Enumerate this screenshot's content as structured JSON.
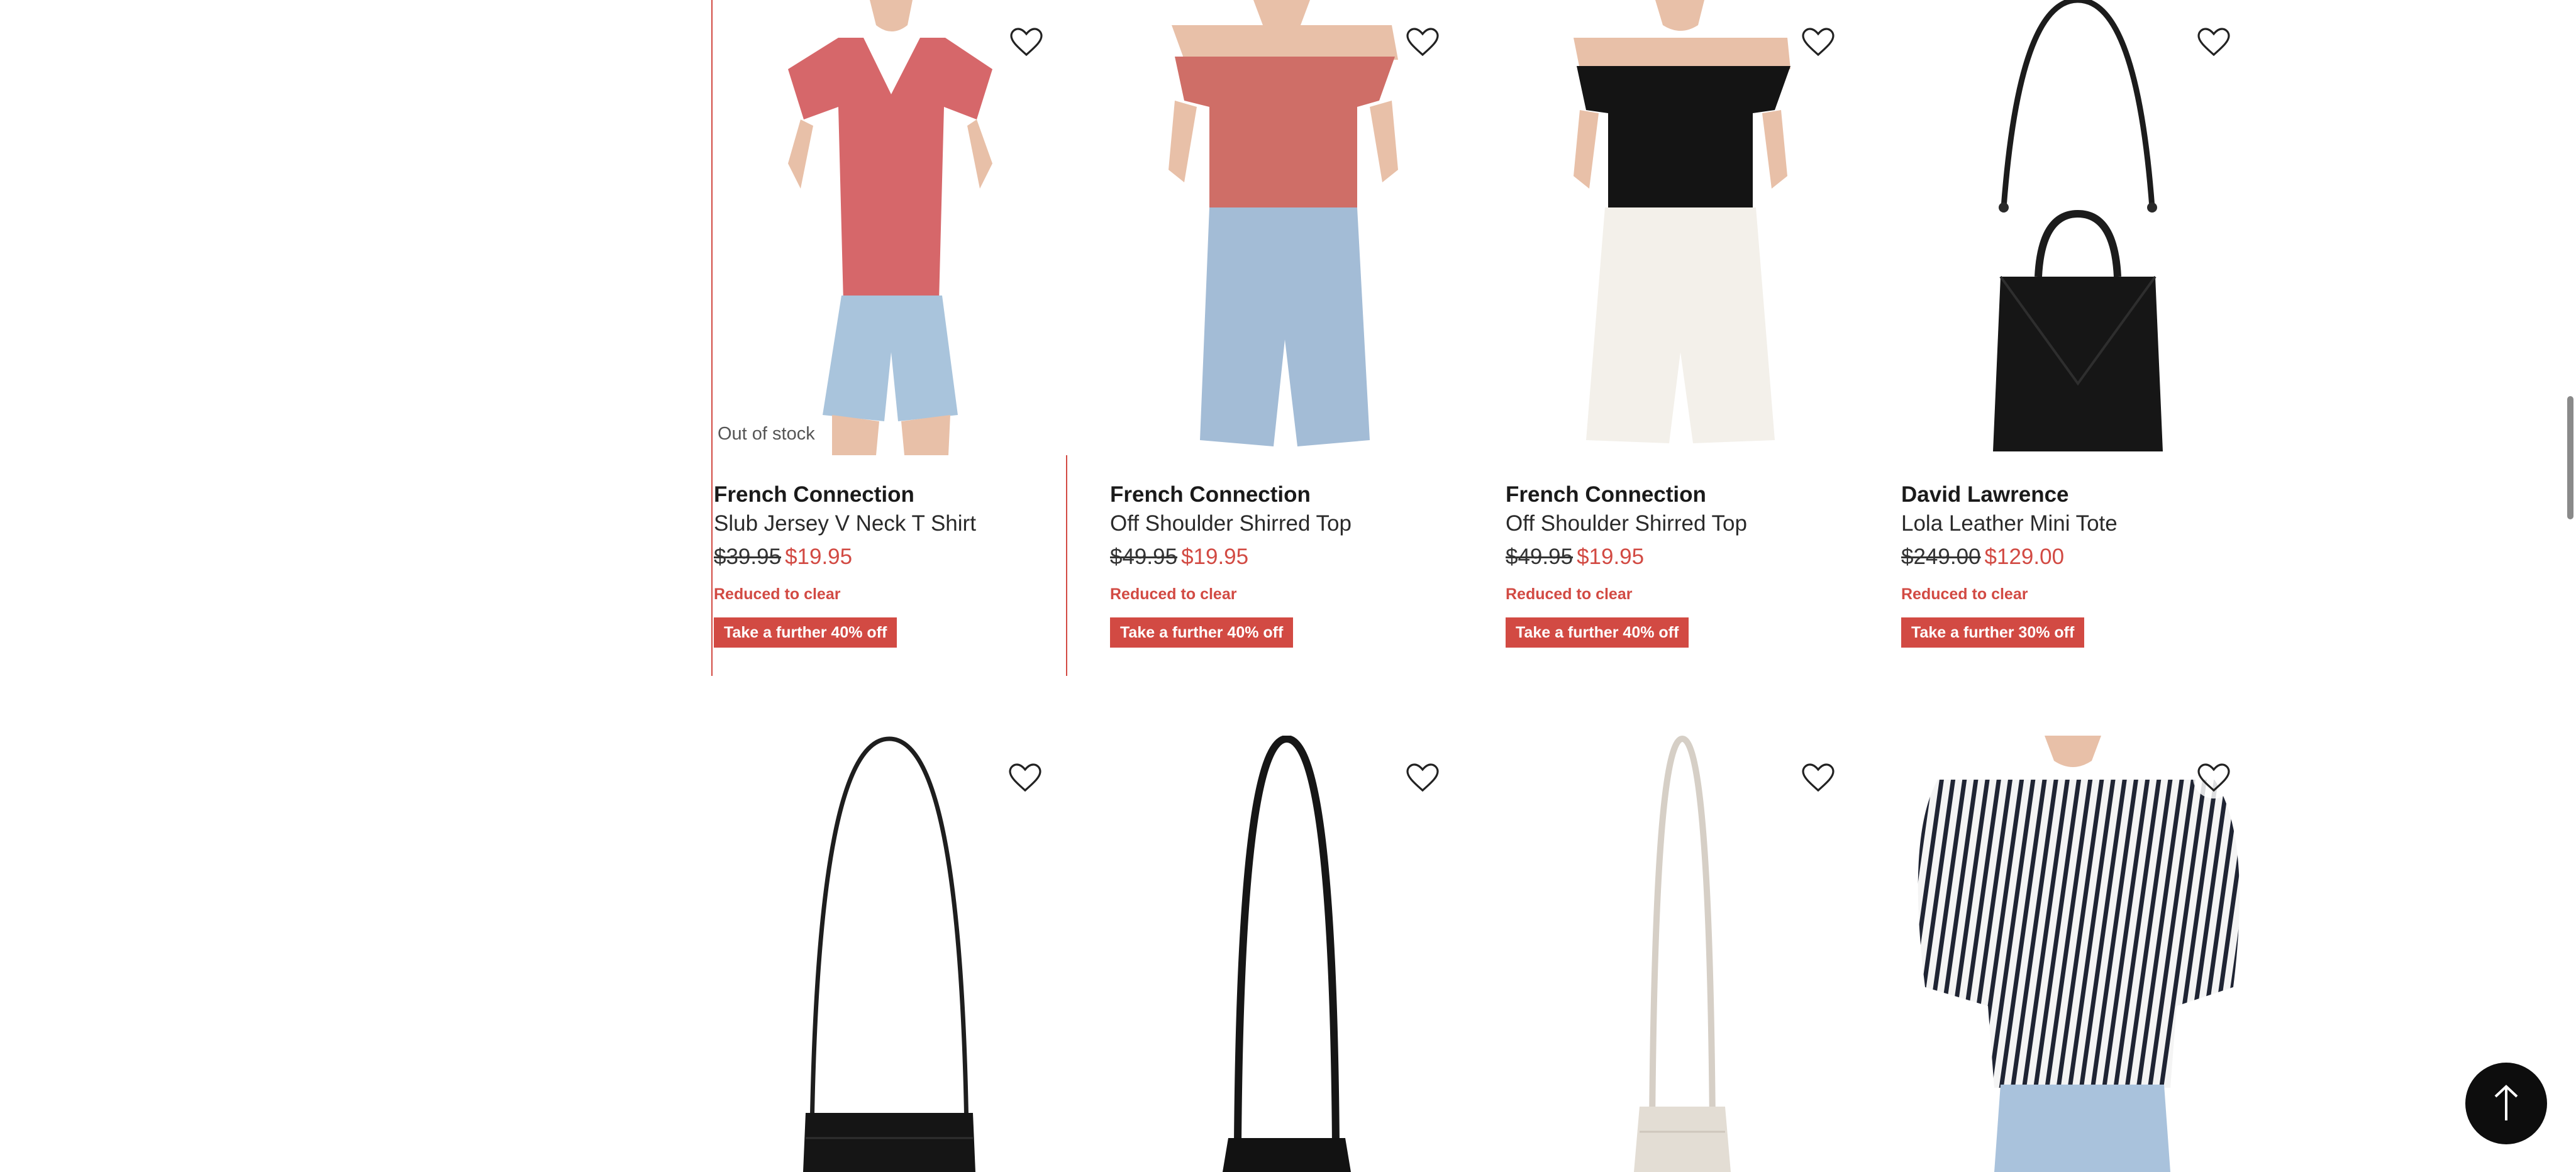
{
  "colors": {
    "accent": "#d24a43",
    "text": "#1a1a1a",
    "background": "#ffffff"
  },
  "products_row1": [
    {
      "brand": "French Connection",
      "name": "Slub Jersey V Neck T Shirt",
      "was_price": "$39.95",
      "now_price": "$19.95",
      "clear_label": "Reduced to clear",
      "promo_label": "Take a further 40% off",
      "stock_label": "Out of stock",
      "image": "pink-v-neck-tshirt-denim-shorts",
      "wishlist_icon": "heart-outline-icon"
    },
    {
      "brand": "French Connection",
      "name": "Off Shoulder Shirred Top",
      "was_price": "$49.95",
      "now_price": "$19.95",
      "clear_label": "Reduced to clear",
      "promo_label": "Take a further 40% off",
      "image": "pink-off-shoulder-top-denim-shorts",
      "wishlist_icon": "heart-outline-icon"
    },
    {
      "brand": "French Connection",
      "name": "Off Shoulder Shirred Top",
      "was_price": "$49.95",
      "now_price": "$19.95",
      "clear_label": "Reduced to clear",
      "promo_label": "Take a further 40% off",
      "image": "black-off-shoulder-top-white-shorts",
      "wishlist_icon": "heart-outline-icon"
    },
    {
      "brand": "David Lawrence",
      "name": "Lola Leather Mini Tote",
      "was_price": "$249.00",
      "now_price": "$129.00",
      "clear_label": "Reduced to clear",
      "promo_label": "Take a further 30% off",
      "image": "black-leather-mini-tote",
      "wishlist_icon": "heart-outline-icon"
    }
  ],
  "products_row2": [
    {
      "image": "black-leather-crossbody-bag",
      "wishlist_icon": "heart-outline-icon"
    },
    {
      "image": "black-crossbody-bag",
      "wishlist_icon": "heart-outline-icon"
    },
    {
      "image": "cream-crossbody-bag",
      "wishlist_icon": "heart-outline-icon"
    },
    {
      "image": "striped-off-shoulder-blouse-denim-shorts",
      "wishlist_icon": "heart-outline-icon"
    }
  ],
  "back_to_top_icon": "arrow-up-icon"
}
